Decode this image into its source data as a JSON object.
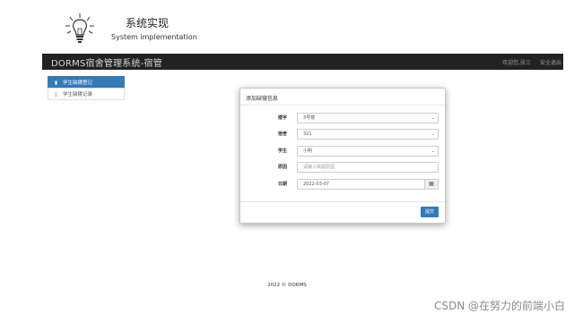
{
  "brand": {
    "title_cn": "系统实现",
    "title_en": "System implementation"
  },
  "navbar": {
    "title": "DORMS宿舍管理系统-宿管",
    "welcome": "欢迎您,张三",
    "logout": "安全退出"
  },
  "sidebar": {
    "items": [
      {
        "label": "学生缺寝登记",
        "icon": "bookmark-icon",
        "active": true
      },
      {
        "label": "学生缺寝记录",
        "icon": "bookmark-outline-icon",
        "active": false
      }
    ]
  },
  "modal": {
    "title": "添加缺寝信息",
    "fields": [
      {
        "label": "楼宇",
        "value": "3号楼",
        "type": "select"
      },
      {
        "label": "宿舍",
        "value": "321",
        "type": "select"
      },
      {
        "label": "学生",
        "value": "小明",
        "type": "select"
      },
      {
        "label": "原因",
        "placeholder": "请输入缺寝原因",
        "type": "text"
      },
      {
        "label": "日期",
        "value": "2022-03-07",
        "type": "date"
      }
    ],
    "submit": "提交"
  },
  "footer": "2022 © DORMS",
  "watermark": "CSDN @在努力的前端小白",
  "colors": {
    "navbar": "#222222",
    "primary": "#337ab7"
  }
}
